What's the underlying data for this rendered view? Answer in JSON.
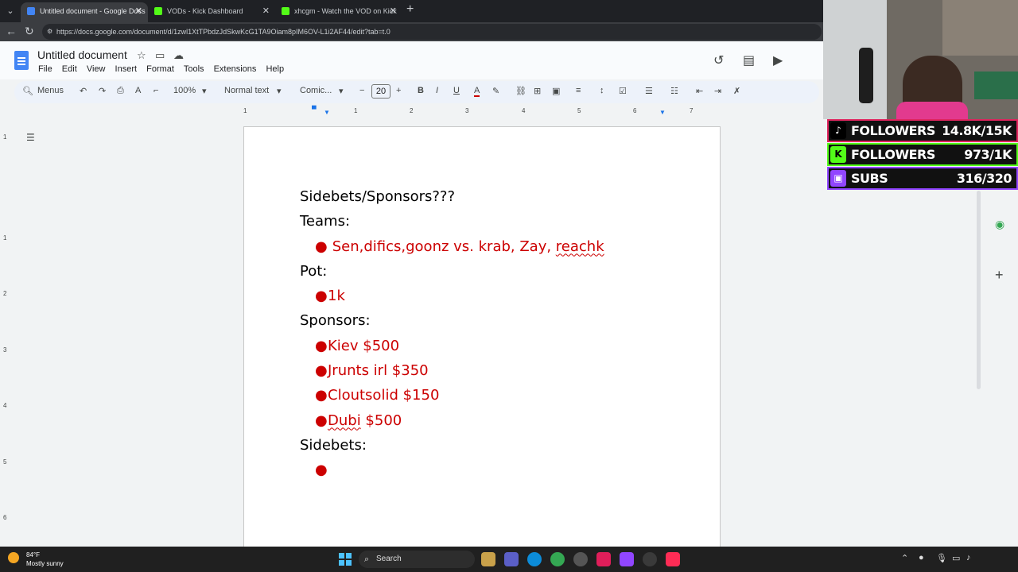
{
  "browser": {
    "tabs": [
      {
        "label": "Untitled document - Google Docs",
        "active": true,
        "favicon": "docs-icon"
      },
      {
        "label": "VODs - Kick Dashboard",
        "active": false,
        "favicon": "kick-icon"
      },
      {
        "label": "xhcgm - Watch the VOD on Kick",
        "active": false,
        "favicon": "kick-icon"
      }
    ],
    "url": "https://docs.google.com/document/d/1zwl1XtTPbdzJdSkwKcG1TA9Oiam8pIM6OV-L1i2AF44/edit?tab=t.0"
  },
  "docs": {
    "title": "Untitled document",
    "menu": [
      "File",
      "Edit",
      "View",
      "Insert",
      "Format",
      "Tools",
      "Extensions",
      "Help"
    ],
    "toolbar": {
      "menus_label": "Menus",
      "zoom": "100%",
      "style": "Normal text",
      "font": "Comic...",
      "font_size": "20"
    },
    "ruler_ticks": [
      "1",
      "1",
      "2",
      "3",
      "4",
      "5",
      "6",
      "7"
    ],
    "vruler_ticks": [
      "1",
      "1",
      "2",
      "3",
      "4",
      "5",
      "6"
    ]
  },
  "document": {
    "lines": [
      {
        "type": "heading",
        "text": "Sidebets/Sponsors???"
      },
      {
        "type": "heading",
        "text": " Teams:"
      },
      {
        "type": "bullet",
        "text": " Sen,difics,goonz vs. krab, Zay, ",
        "squiggle": "reachk"
      },
      {
        "type": "heading",
        "text": "Pot:"
      },
      {
        "type": "bullet",
        "text": "1k"
      },
      {
        "type": "heading",
        "text": "Sponsors:"
      },
      {
        "type": "bullet",
        "text": "Kiev $500"
      },
      {
        "type": "bullet",
        "text": "Jrunts irl $350"
      },
      {
        "type": "bullet",
        "text": "Cloutsolid $150"
      },
      {
        "type": "bullet",
        "squiggle_first": "Dubi",
        "text": " $500"
      },
      {
        "type": "heading",
        "text": "Sidebets:"
      },
      {
        "type": "bullet",
        "text": ""
      }
    ],
    "colors": {
      "heading": "#000000",
      "bullet": "#cc0000"
    }
  },
  "overlay": {
    "stats": [
      {
        "platform": "tiktok-icon",
        "label": "FOLLOWERS",
        "value": "14.8K/15K",
        "color": "#e0245e"
      },
      {
        "platform": "kick-icon",
        "label": "FOLLOWERS",
        "value": "973/1K",
        "color": "#53fc18"
      },
      {
        "platform": "twitch-icon",
        "label": "SUBS",
        "value": "316/320",
        "color": "#9146ff"
      }
    ]
  },
  "taskbar": {
    "weather_temp": "84°F",
    "weather_desc": "Mostly sunny",
    "search_label": "Search"
  }
}
